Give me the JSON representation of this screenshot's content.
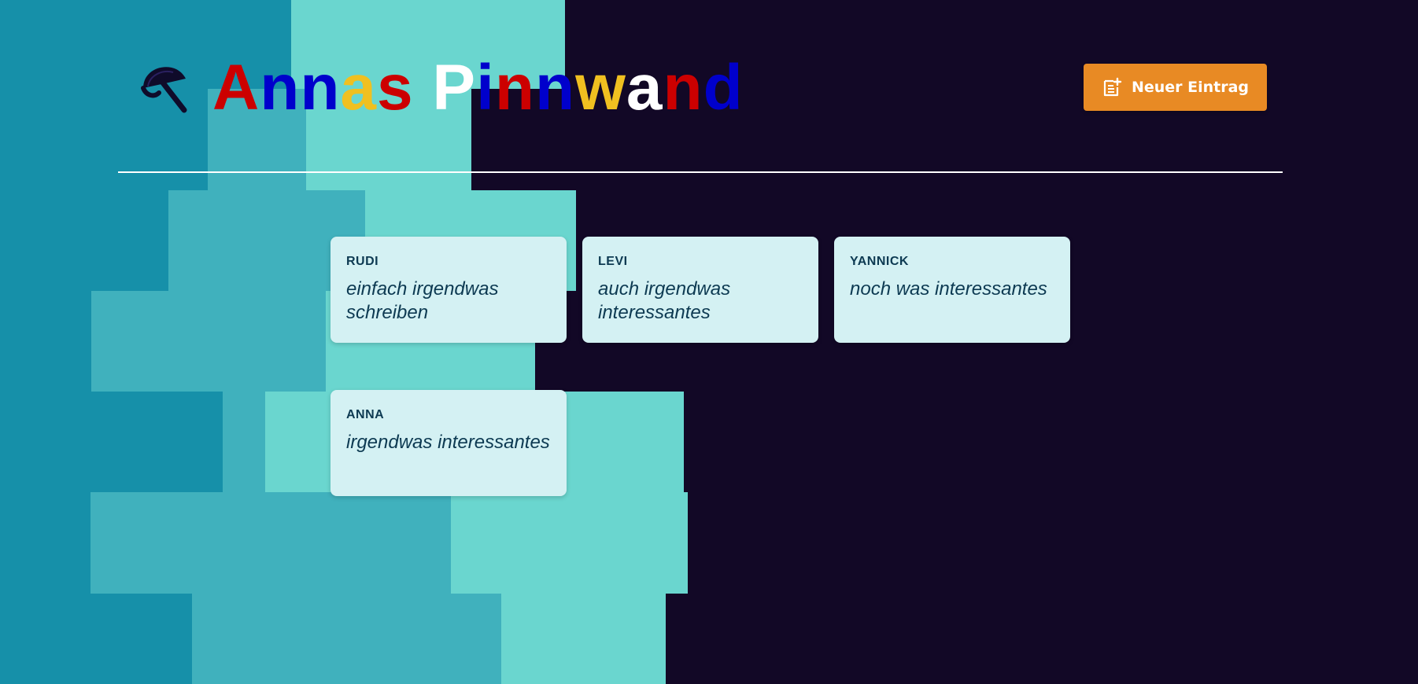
{
  "header": {
    "logo_icon": "umbrella-icon",
    "title": "Annas Pinnwand",
    "title_letter_colors": [
      "#cc0000",
      "#0000cc",
      "#0000cc",
      "#f0c020",
      "#cc0000",
      "#ffffff",
      "#0000cc",
      "#cc0000",
      "#0000cc",
      "#f0c020",
      "#ffffff",
      "#cc0000",
      "#0000cc"
    ],
    "new_entry_button_label": "Neuer Eintrag",
    "new_entry_icon": "add-note-icon"
  },
  "notes": [
    {
      "author": "RUDI",
      "text": "einfach irgendwas schreiben"
    },
    {
      "author": "LEVI",
      "text": "auch irgendwas interessantes"
    },
    {
      "author": "YANNICK",
      "text": "noch was interessantes"
    },
    {
      "author": "ANNA",
      "text": "irgendwas interessantes"
    }
  ],
  "colors": {
    "background_dark": "#120826",
    "accent_orange": "#e88a24",
    "card_background": "#d4f1f3",
    "card_text": "#0d3a52",
    "teal_dark": "#1690a9",
    "teal_mid": "#40b1bd",
    "teal_light": "#6ad6cf"
  }
}
